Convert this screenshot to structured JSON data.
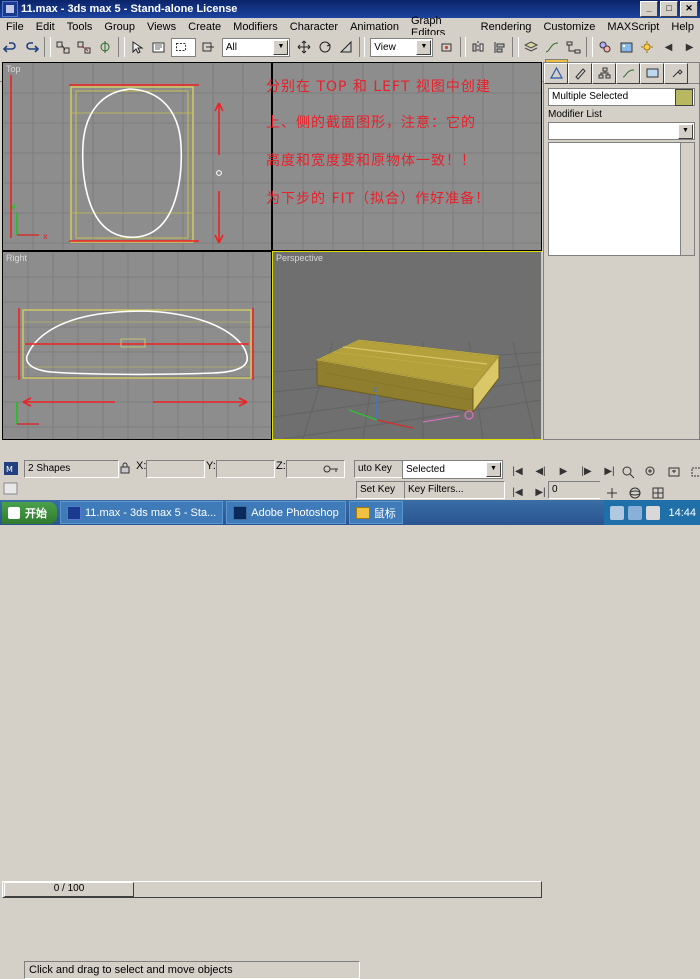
{
  "window": {
    "title": "11.max - 3ds max 5 - Stand-alone License",
    "icon": "max-app-icon",
    "buttons": [
      "_",
      "□",
      "✕"
    ]
  },
  "menu": [
    "File",
    "Edit",
    "Tools",
    "Group",
    "Views",
    "Create",
    "Modifiers",
    "Character",
    "Animation",
    "Graph Editors",
    "Rendering",
    "Customize",
    "MAXScript",
    "Help"
  ],
  "toolbar": {
    "selection_filter": "All",
    "coord_system": "View",
    "named_selection_placeholder": ""
  },
  "viewports": [
    {
      "name": "vp-top",
      "label": "Top",
      "active": false
    },
    {
      "name": "vp-left",
      "label": "",
      "active": false
    },
    {
      "name": "vp-right",
      "label": "Right",
      "active": false
    },
    {
      "name": "vp-perspective",
      "label": "Perspective",
      "active": true
    }
  ],
  "annotation": {
    "lines": [
      "分别在 TOP 和 LEFT 视图中创建",
      "上、侧的截面图形，注意：它的",
      "高度和宽度要和原物体一致！！",
      "为下步的 FIT（拟合）作好准备！"
    ],
    "color": "#e8202a"
  },
  "command_panel": {
    "tabs": [
      "create-tab",
      "modify-tab",
      "hierarchy-tab",
      "motion-tab",
      "display-tab",
      "utilities-tab"
    ],
    "selection_name": "Multiple Selected",
    "object_color": "#b8b860",
    "modifier_list_label": "Modifier List",
    "modifier_stack_value": ""
  },
  "track_bar": {
    "current_frame_label": "0 / 100"
  },
  "status": {
    "object_count": "2 Shapes",
    "lock_icon": "lock-icon",
    "x_label": "X:",
    "x_value": "",
    "y_label": "Y:",
    "y_value": "",
    "z_label": "Z:",
    "z_value": "",
    "grid_label": "",
    "prompt": "Click and drag to select and move objects",
    "auto_key": "uto Key",
    "set_key": "Set Key",
    "key_filters": "Key Filters...",
    "selection_set": "Selected",
    "frame_field": "0"
  },
  "taskbar": {
    "start": "开始",
    "items": [
      {
        "label": "11.max - 3ds max 5 - Sta...",
        "icon": "max-app-icon"
      },
      {
        "label": "Adobe Photoshop",
        "icon": "photoshop-icon"
      },
      {
        "label": "鼠标",
        "icon": "folder-icon"
      }
    ],
    "clock": "14:44",
    "tray_icons": [
      "volume-icon",
      "network-icon",
      "ime-icon"
    ]
  }
}
